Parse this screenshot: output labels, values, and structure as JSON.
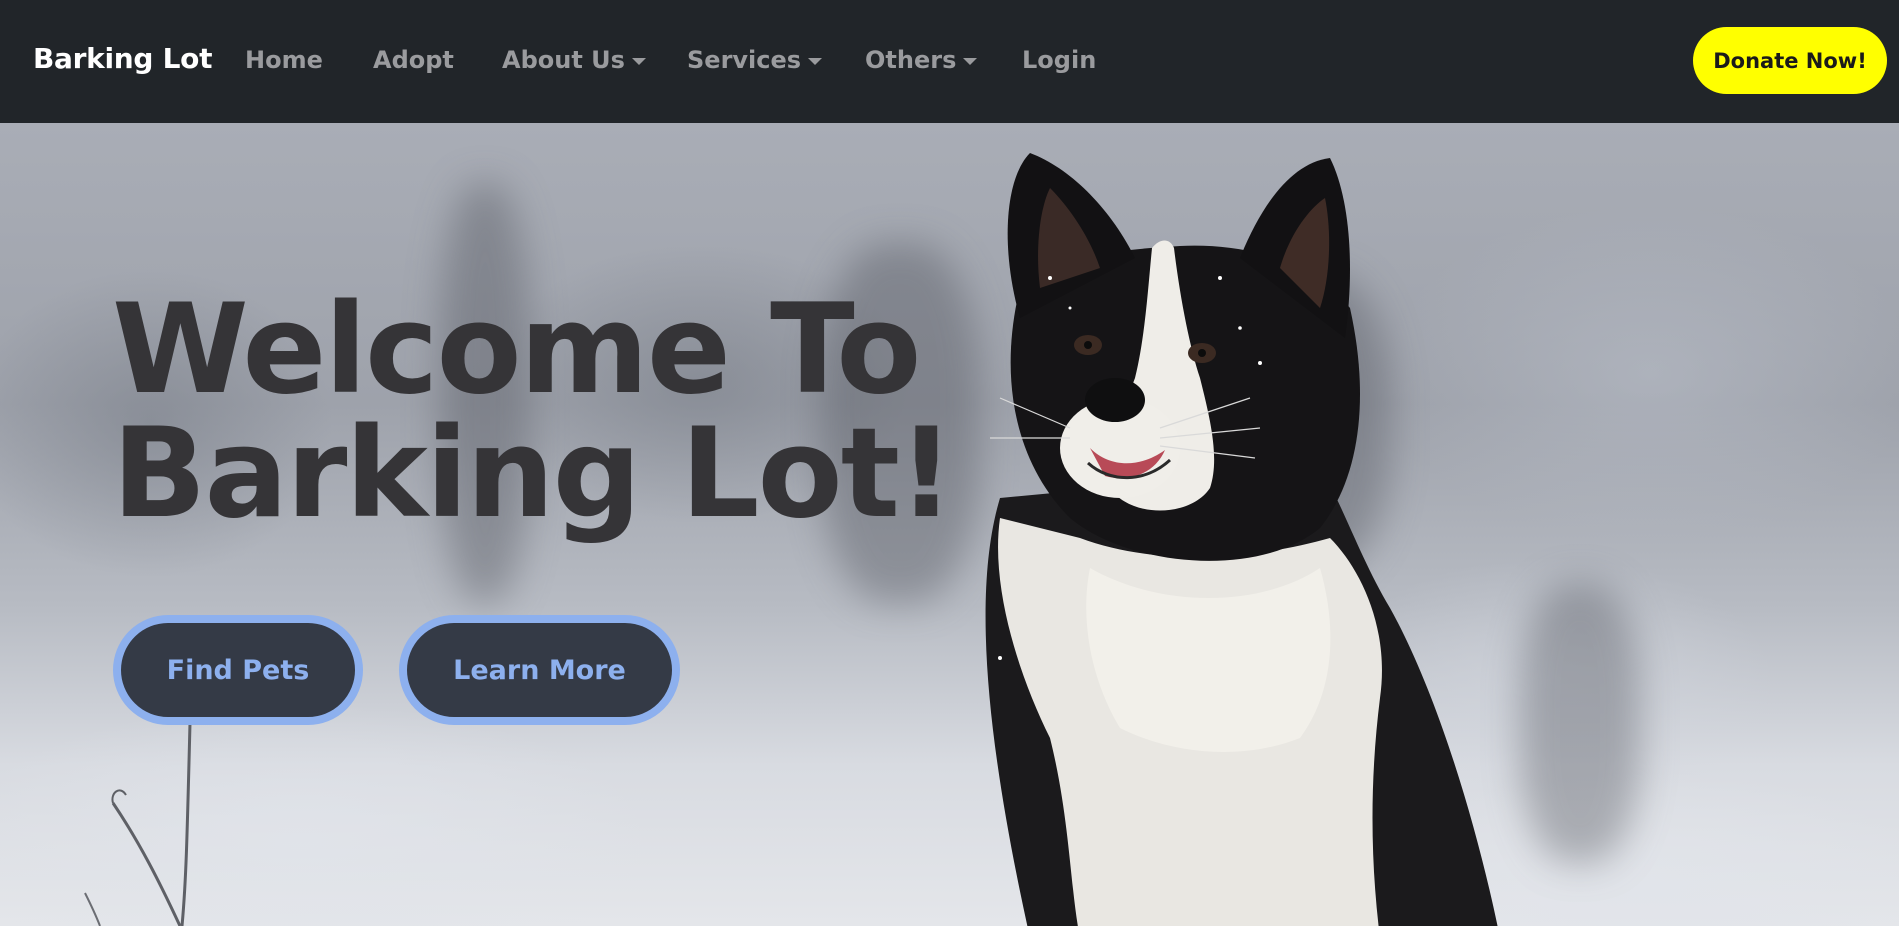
{
  "navbar": {
    "brand": "Barking Lot",
    "items": [
      {
        "label": "Home",
        "dropdown": false
      },
      {
        "label": "Adopt",
        "dropdown": false
      },
      {
        "label": "About Us",
        "dropdown": true
      },
      {
        "label": "Services",
        "dropdown": true
      },
      {
        "label": "Others",
        "dropdown": true
      },
      {
        "label": "Login",
        "dropdown": false
      }
    ],
    "donate_label": "Donate Now!"
  },
  "hero": {
    "headline_line1": "Welcome To",
    "headline_line2": "Barking Lot!",
    "find_pets_label": "Find Pets",
    "learn_more_label": "Learn More",
    "image_subject": "black-and-white border collie in snow"
  },
  "colors": {
    "navbar_bg": "#212529",
    "donate_bg": "#ffff00",
    "button_accent": "#8db0ee",
    "headline": "#353437"
  }
}
